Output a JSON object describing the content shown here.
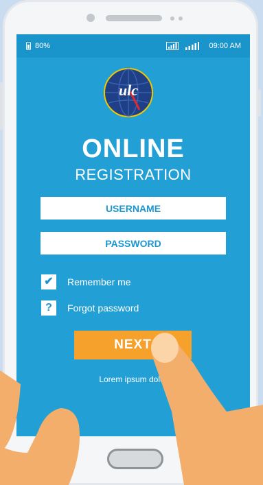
{
  "status_bar": {
    "battery": "80%",
    "time": "09:00 AM"
  },
  "app": {
    "title_line1": "ONLINE",
    "title_line2": "REGISTRATION",
    "logo_text": "ulc"
  },
  "form": {
    "username_placeholder": "USERNAME",
    "password_placeholder": "PASSWORD",
    "remember_label": "Remember me",
    "remember_checked": true,
    "forgot_label": "Forgot password",
    "next_label": "NEXT",
    "footer_text": "Lorem ipsum dolor"
  },
  "colors": {
    "screen": "#22a0d6",
    "button": "#f5a12c",
    "hand": "#f3ae6c"
  }
}
